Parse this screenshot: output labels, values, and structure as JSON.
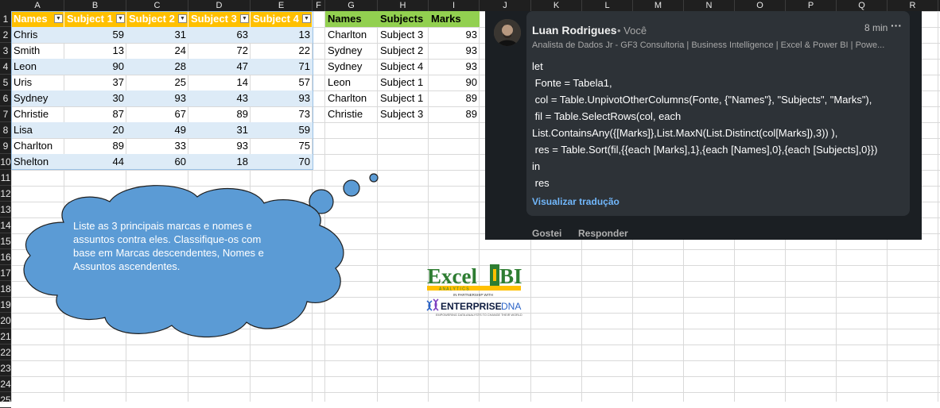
{
  "columns": [
    "A",
    "B",
    "C",
    "D",
    "E",
    "F",
    "G",
    "H",
    "I",
    "J",
    "K",
    "L",
    "M",
    "N",
    "O",
    "P",
    "Q",
    "R"
  ],
  "rows": [
    "1",
    "2",
    "3",
    "4",
    "5",
    "6",
    "7",
    "8",
    "9",
    "10",
    "11",
    "12",
    "13",
    "14",
    "15",
    "16",
    "17",
    "18",
    "19",
    "20",
    "21",
    "22",
    "23",
    "24",
    "25"
  ],
  "table1": {
    "headers": [
      "Names",
      "Subject 1",
      "Subject 2",
      "Subject 3",
      "Subject 4"
    ],
    "rows": [
      [
        "Chris",
        "59",
        "31",
        "63",
        "13"
      ],
      [
        "Smith",
        "13",
        "24",
        "72",
        "22"
      ],
      [
        "Leon",
        "90",
        "28",
        "47",
        "71"
      ],
      [
        "Uris",
        "37",
        "25",
        "14",
        "57"
      ],
      [
        "Sydney",
        "30",
        "93",
        "43",
        "93"
      ],
      [
        "Christie",
        "87",
        "67",
        "89",
        "73"
      ],
      [
        "Lisa",
        "20",
        "49",
        "31",
        "59"
      ],
      [
        "Charlton",
        "89",
        "33",
        "93",
        "75"
      ],
      [
        "Shelton",
        "44",
        "60",
        "18",
        "70"
      ]
    ]
  },
  "table2": {
    "headers": [
      "Names",
      "Subjects",
      "Marks"
    ],
    "rows": [
      [
        "Charlton",
        "Subject 3",
        "93"
      ],
      [
        "Sydney",
        "Subject 2",
        "93"
      ],
      [
        "Sydney",
        "Subject 4",
        "93"
      ],
      [
        "Leon",
        "Subject 1",
        "90"
      ],
      [
        "Charlton",
        "Subject 1",
        "89"
      ],
      [
        "Christie",
        "Subject 3",
        "89"
      ]
    ]
  },
  "callout": {
    "text": "Liste as 3 principais marcas e nomes e assuntos contra eles. Classifique-os com base em Marcas descendentes, Nomes e Assuntos ascendentes."
  },
  "logo": {
    "excel": "Excel",
    "bi": "BI",
    "analytics": "A N A L Y T I C S",
    "partnership": "IN PARTNERSHIP WITH",
    "enterprise": "ENTERPRISE",
    "dna": "DNA",
    "tagline": "EMPOWERING DATA ANALYSTS TO CHANGE THEIR WORLD"
  },
  "comment": {
    "author": "Luan Rodrigues",
    "you": "• Você",
    "time": "8 min",
    "more": "···",
    "headline": "Analista de Dados Jr - GF3 Consultoria | Business Intelligence | Excel & Power BI | Powe...",
    "code": [
      "let",
      " Fonte = Tabela1,",
      " col = Table.UnpivotOtherColumns(Fonte, {\"Names\"}, \"Subjects\", \"Marks\"),",
      " fil = Table.SelectRows(col, each",
      "List.ContainsAny({[Marks]},List.MaxN(List.Distinct(col[Marks]),3)) ),",
      " res = Table.Sort(fil,{{each [Marks],1},{each [Names],0},{each [Subjects],0}})",
      "in",
      " res"
    ],
    "translate": "Visualizar tradução",
    "like": "Gostei",
    "reply": "Responder"
  },
  "colors": {
    "table1_header": "#ffc000",
    "table2_header": "#92d050",
    "band": "#ddebf7",
    "cloud": "#5b9bd5",
    "link": "#71b7fb"
  }
}
